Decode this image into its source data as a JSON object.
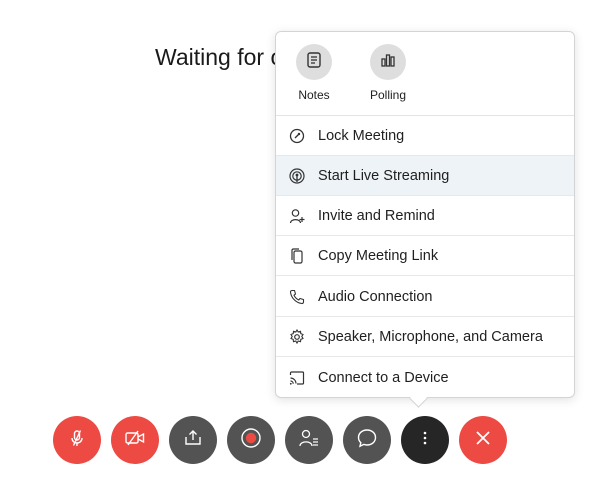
{
  "meeting": {
    "waiting_text": "Waiting for o"
  },
  "more_menu": {
    "quick_actions": [
      {
        "label": "Notes",
        "icon": "notes-icon"
      },
      {
        "label": "Polling",
        "icon": "polling-icon"
      }
    ],
    "items": [
      {
        "label": "Lock Meeting",
        "icon": "lock-icon"
      },
      {
        "label": "Start Live Streaming",
        "icon": "live-stream-icon",
        "highlighted": true
      },
      {
        "label": "Invite and Remind",
        "icon": "invite-icon"
      },
      {
        "label": "Copy Meeting Link",
        "icon": "copy-icon"
      },
      {
        "label": "Audio Connection",
        "icon": "phone-icon"
      },
      {
        "label": "Speaker, Microphone, and Camera",
        "icon": "gear-icon"
      },
      {
        "label": "Connect to a Device",
        "icon": "cast-icon"
      }
    ]
  },
  "controls": [
    {
      "name": "mute",
      "icon": "microphone-muted-icon",
      "color": "#ec4a43"
    },
    {
      "name": "video",
      "icon": "video-off-icon",
      "color": "#ec4a43"
    },
    {
      "name": "share",
      "icon": "share-icon",
      "color": "#535353"
    },
    {
      "name": "record",
      "icon": "record-icon",
      "color": "#535353"
    },
    {
      "name": "participants",
      "icon": "participants-icon",
      "color": "#535353"
    },
    {
      "name": "chat",
      "icon": "chat-icon",
      "color": "#535353"
    },
    {
      "name": "more",
      "icon": "more-icon",
      "color": "#262626"
    },
    {
      "name": "leave",
      "icon": "close-icon",
      "color": "#ec4a43"
    }
  ],
  "colors": {
    "accent_red": "#ec4a43",
    "button_gray": "#535353",
    "highlight": "#eef3f7"
  }
}
